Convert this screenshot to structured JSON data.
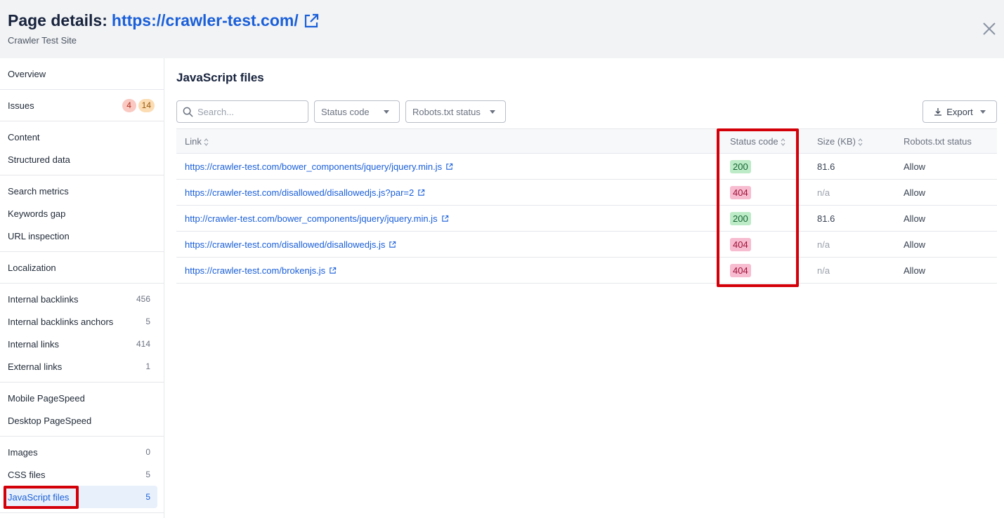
{
  "header": {
    "title_prefix": "Page details:",
    "title_url": "https://crawler-test.com/",
    "subtitle": "Crawler Test Site"
  },
  "sidebar": {
    "groups": [
      [
        {
          "label": "Overview"
        }
      ],
      [
        {
          "label": "Issues",
          "badges": [
            "4",
            "14"
          ]
        }
      ],
      [
        {
          "label": "Content"
        },
        {
          "label": "Structured data"
        }
      ],
      [
        {
          "label": "Search metrics"
        },
        {
          "label": "Keywords gap"
        },
        {
          "label": "URL inspection"
        }
      ],
      [
        {
          "label": "Localization"
        }
      ],
      [
        {
          "label": "Internal backlinks",
          "count": "456"
        },
        {
          "label": "Internal backlinks anchors",
          "count": "5"
        },
        {
          "label": "Internal links",
          "count": "414"
        },
        {
          "label": "External links",
          "count": "1"
        }
      ],
      [
        {
          "label": "Mobile PageSpeed"
        },
        {
          "label": "Desktop PageSpeed"
        }
      ],
      [
        {
          "label": "Images",
          "count": "0"
        },
        {
          "label": "CSS files",
          "count": "5"
        },
        {
          "label": "JavaScript files",
          "count": "5",
          "active": true
        }
      ]
    ]
  },
  "main": {
    "title": "JavaScript files",
    "search_placeholder": "Search...",
    "filter_status": "Status code",
    "filter_robots": "Robots.txt status",
    "export_label": "Export",
    "columns": [
      "Link",
      "Status code",
      "Size (KB)",
      "Robots.txt status"
    ],
    "rows": [
      {
        "link": "https://crawler-test.com/bower_components/jquery/jquery.min.js",
        "status": "200",
        "size": "81.6",
        "robots": "Allow"
      },
      {
        "link": "https://crawler-test.com/disallowed/disallowedjs.js?par=2",
        "status": "404",
        "size": "n/a",
        "robots": "Allow"
      },
      {
        "link": "http://crawler-test.com/bower_components/jquery/jquery.min.js",
        "status": "200",
        "size": "81.6",
        "robots": "Allow"
      },
      {
        "link": "https://crawler-test.com/disallowed/disallowedjs.js",
        "status": "404",
        "size": "n/a",
        "robots": "Allow"
      },
      {
        "link": "https://crawler-test.com/brokenjs.js",
        "status": "404",
        "size": "n/a",
        "robots": "Allow"
      }
    ]
  },
  "colors": {
    "accent": "#1a5fd9",
    "status_ok_bg": "#bdebc7",
    "status_err_bg": "#f7bcd0",
    "highlight": "#d40009"
  }
}
